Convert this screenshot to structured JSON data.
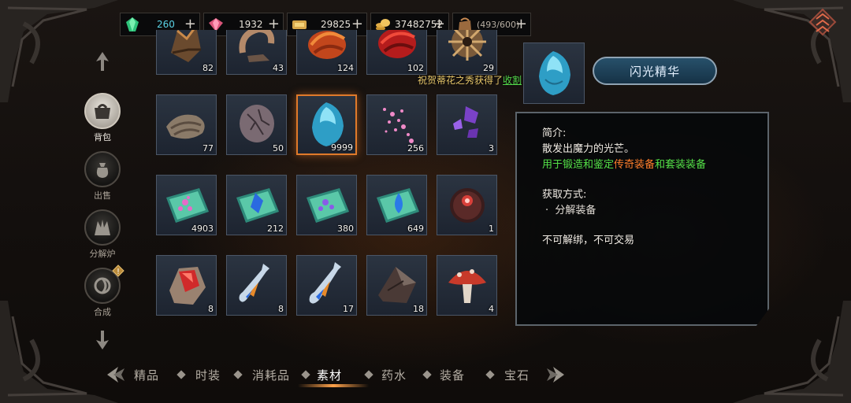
{
  "currency": {
    "jade": {
      "value": "260",
      "icon": "green-gem-icon"
    },
    "ruby": {
      "value": "1932",
      "icon": "pink-gem-icon"
    },
    "ticket": {
      "value": "29825",
      "icon": "gold-ticket-icon"
    },
    "gold": {
      "value": "37482752",
      "icon": "gold-coin-stack-icon"
    },
    "bag": {
      "value": "(493/600)",
      "icon": "bag-capacity-icon"
    },
    "plus": "+"
  },
  "side_nav": [
    {
      "label": "背包",
      "icon": "backpack-icon",
      "active": true
    },
    {
      "label": "出售",
      "icon": "money-bag-icon",
      "active": false
    },
    {
      "label": "分解炉",
      "icon": "furnace-icon",
      "active": false
    },
    {
      "label": "合成",
      "icon": "synthesis-icon",
      "active": false,
      "alert": "!"
    }
  ],
  "items": [
    {
      "name": "brown-spiky-ore",
      "count": "82"
    },
    {
      "name": "bone-claw",
      "count": "43"
    },
    {
      "name": "orange-fur",
      "count": "124"
    },
    {
      "name": "red-fur",
      "count": "102"
    },
    {
      "name": "spiked-shield-shard",
      "count": "29"
    },
    {
      "name": "wrapped-cloth",
      "count": "77"
    },
    {
      "name": "cracked-egg-stone",
      "count": "50"
    },
    {
      "name": "blue-gem-shard",
      "count": "9999",
      "selected": true
    },
    {
      "name": "pink-sparkle-dust",
      "count": "256"
    },
    {
      "name": "purple-crystal-shards",
      "count": "3"
    },
    {
      "name": "pink-powder-plate",
      "count": "4903"
    },
    {
      "name": "blue-crystal-plate",
      "count": "212"
    },
    {
      "name": "violet-powder-plate",
      "count": "380"
    },
    {
      "name": "blue-drop-plate",
      "count": "649"
    },
    {
      "name": "red-eye-orb",
      "count": "1"
    },
    {
      "name": "red-ruby-ore",
      "count": "8"
    },
    {
      "name": "potion-vial-small",
      "count": "8"
    },
    {
      "name": "potion-vial",
      "count": "17"
    },
    {
      "name": "dark-rock-slab",
      "count": "18"
    },
    {
      "name": "red-mushroom",
      "count": "4"
    }
  ],
  "notice": {
    "text": "祝贺蒂花之秀获得了",
    "link": "收割"
  },
  "detail": {
    "name": "闪光精华",
    "intro_title": "简介:",
    "intro_line1": "散发出魔力的光芒。",
    "intro_line2_a": "用于锻造和鉴定",
    "intro_line2_b": "传奇装备",
    "intro_line2_c": "和",
    "intro_line2_d": "套装装备",
    "source_title": "获取方式:",
    "source_item": "分解装备",
    "bullet": "·",
    "bind_note": "不可解绑，不可交易"
  },
  "tabs": [
    "精品",
    "时装",
    "消耗品",
    "素材",
    "药水",
    "装备",
    "宝石"
  ],
  "active_tab": 3,
  "colors": {
    "accent_orange": "#ff7e2b",
    "accent_green": "#54e047",
    "selected_border": "#e07a2a",
    "plate_blue": "#27506a"
  }
}
